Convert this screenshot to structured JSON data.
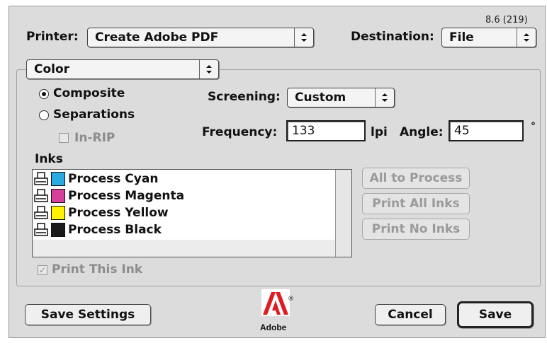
{
  "version": "8.6 (219)",
  "printer": {
    "label": "Printer:",
    "value": "Create Adobe PDF"
  },
  "destination": {
    "label": "Destination:",
    "value": "File"
  },
  "panel_select": {
    "value": "Color"
  },
  "output_mode": {
    "composite": {
      "label": "Composite",
      "selected": true
    },
    "separations": {
      "label": "Separations",
      "selected": false
    },
    "in_rip": {
      "label": "In-RIP",
      "checked": false,
      "enabled": false
    }
  },
  "screening": {
    "label": "Screening:",
    "value": "Custom"
  },
  "frequency": {
    "label": "Frequency:",
    "value": "133",
    "unit": "lpi"
  },
  "angle": {
    "label": "Angle:",
    "value": "45",
    "unit": "°"
  },
  "inks": {
    "label": "Inks",
    "items": [
      {
        "name": "Process Cyan",
        "color": "#29abe2"
      },
      {
        "name": "Process Magenta",
        "color": "#d4409a"
      },
      {
        "name": "Process Yellow",
        "color": "#fff200"
      },
      {
        "name": "Process Black",
        "color": "#1a1a1a"
      }
    ]
  },
  "ink_buttons": {
    "all_to_process": "All to Process",
    "print_all_inks": "Print All Inks",
    "print_no_inks": "Print No Inks"
  },
  "print_this_ink": {
    "label": "Print This Ink",
    "checked": true,
    "enabled": false
  },
  "footer": {
    "save_settings": "Save Settings",
    "cancel": "Cancel",
    "save": "Save",
    "logo_text": "Adobe",
    "logo_reg": "®"
  }
}
